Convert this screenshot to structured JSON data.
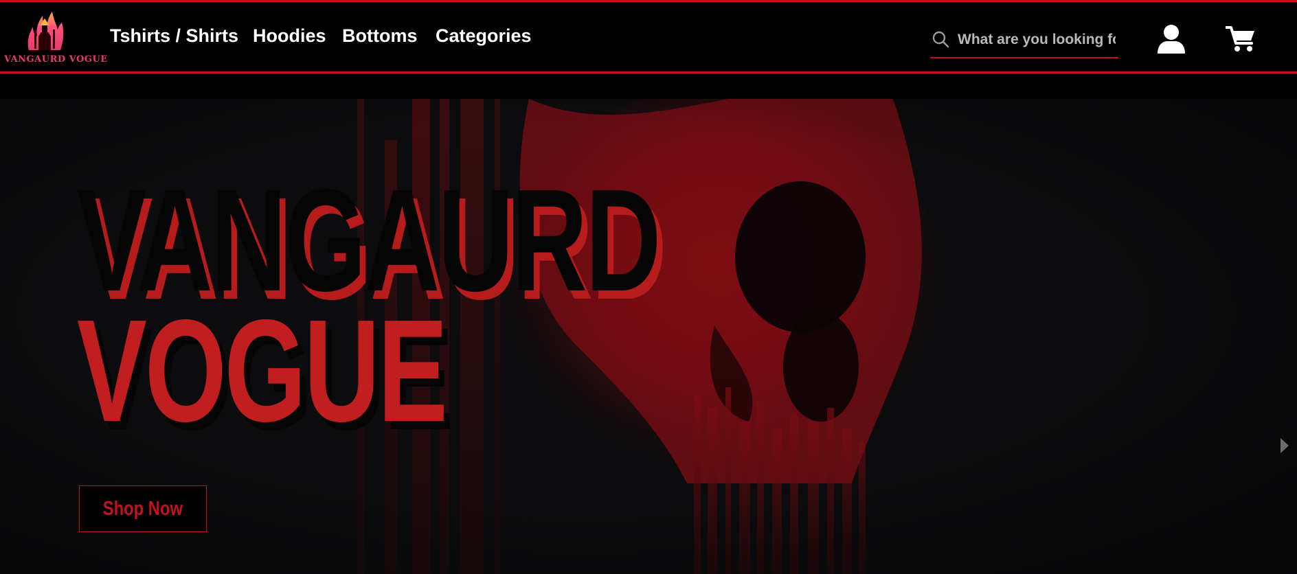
{
  "brand": {
    "logo_text": "vangaurd vogue",
    "accent_color": "#c1121f",
    "logo_color": "#e83a6b"
  },
  "nav": {
    "items": [
      {
        "label": "Tshirts / Shirts"
      },
      {
        "label": "Hoodies"
      },
      {
        "label": "Bottoms"
      },
      {
        "label": "Categories"
      }
    ]
  },
  "search": {
    "placeholder": "What are you looking for ?",
    "icon": "search-icon"
  },
  "header_icons": [
    "user-icon",
    "cart-icon"
  ],
  "hero": {
    "title_line1": "VANGAURD",
    "title_line2": "VOGUE",
    "cta_label": "Shop Now",
    "next_icon": "chevron-right-icon",
    "title_color_primary": "#050505",
    "title_color_accent": "#c11f1f",
    "background_color": "#0c0c0e"
  }
}
